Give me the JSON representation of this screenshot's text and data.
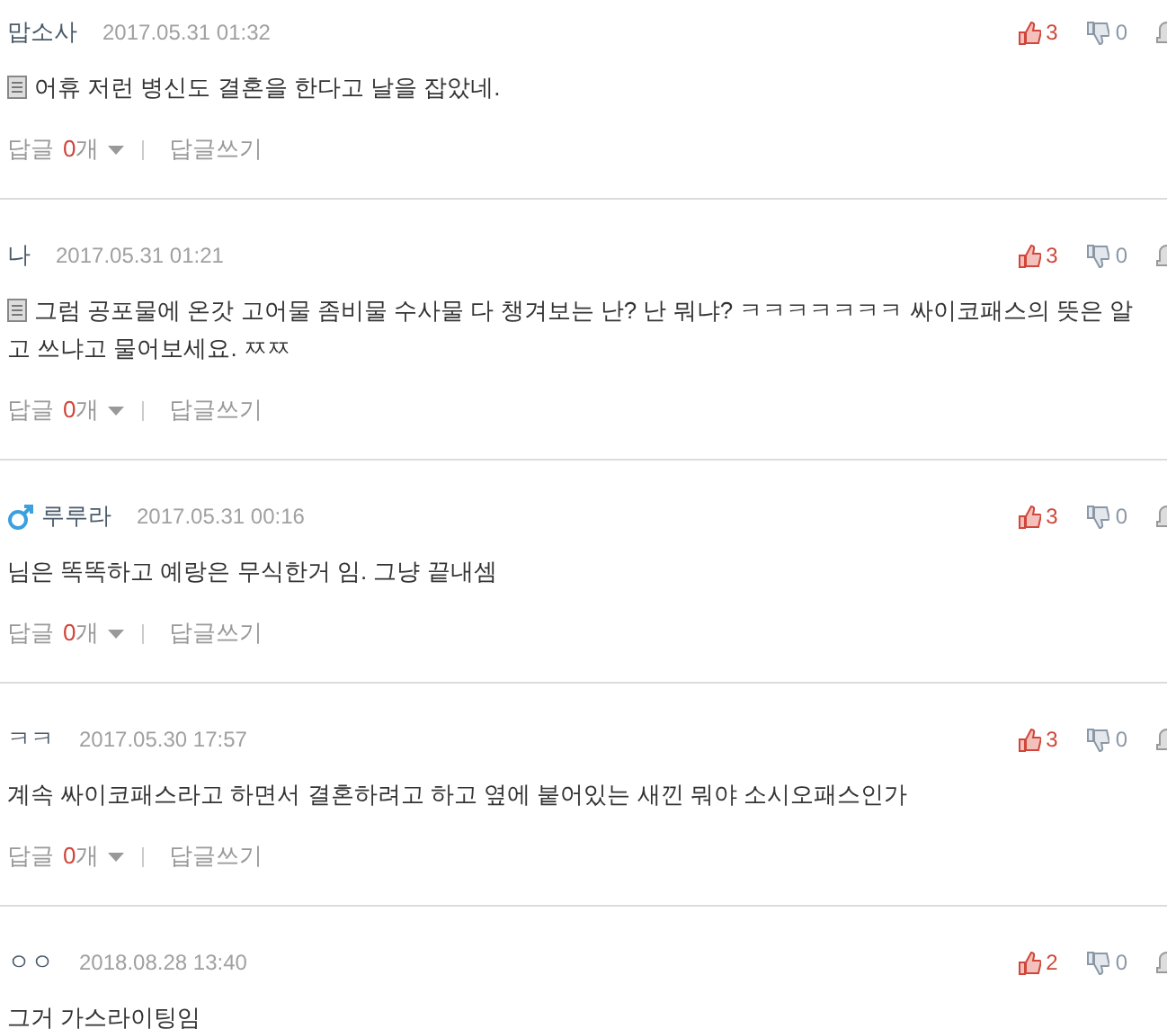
{
  "comments": [
    {
      "author": "맙소사",
      "male": false,
      "date": "2017.05.31 01:32",
      "memo": true,
      "text": "어휴 저런 병신도 결혼을 한다고 날을 잡았네.",
      "likes": "3",
      "dislikes": "0",
      "reply": {
        "label": "답글",
        "count": "0",
        "unit": "개",
        "write": "답글쓰기"
      }
    },
    {
      "author": "나",
      "male": false,
      "date": "2017.05.31 01:21",
      "memo": true,
      "text": "그럼 공포물에 온갓 고어물 좀비물 수사물 다 챙겨보는 난? 난 뭐냐? ㅋㅋㅋㅋㅋㅋㅋ 싸이코패스의 뜻은 알고 쓰냐고 물어보세요. ㅉㅉ",
      "likes": "3",
      "dislikes": "0",
      "reply": {
        "label": "답글",
        "count": "0",
        "unit": "개",
        "write": "답글쓰기"
      }
    },
    {
      "author": "루루라",
      "male": true,
      "date": "2017.05.31 00:16",
      "memo": false,
      "text": "님은 똑똑하고 예랑은 무식한거 임. 그냥 끝내셈",
      "likes": "3",
      "dislikes": "0",
      "reply": {
        "label": "답글",
        "count": "0",
        "unit": "개",
        "write": "답글쓰기"
      }
    },
    {
      "author": "ㅋㅋ",
      "male": false,
      "date": "2017.05.30 17:57",
      "memo": false,
      "text": "계속 싸이코패스라고 하면서 결혼하려고 하고 옆에 붙어있는 새낀 뭐야 소시오패스인가",
      "likes": "3",
      "dislikes": "0",
      "reply": {
        "label": "답글",
        "count": "0",
        "unit": "개",
        "write": "답글쓰기"
      }
    },
    {
      "author": "ㅇㅇ",
      "male": false,
      "date": "2018.08.28 13:40",
      "memo": false,
      "text": "그거 가스라이팅임",
      "likes": "2",
      "dislikes": "0"
    }
  ]
}
